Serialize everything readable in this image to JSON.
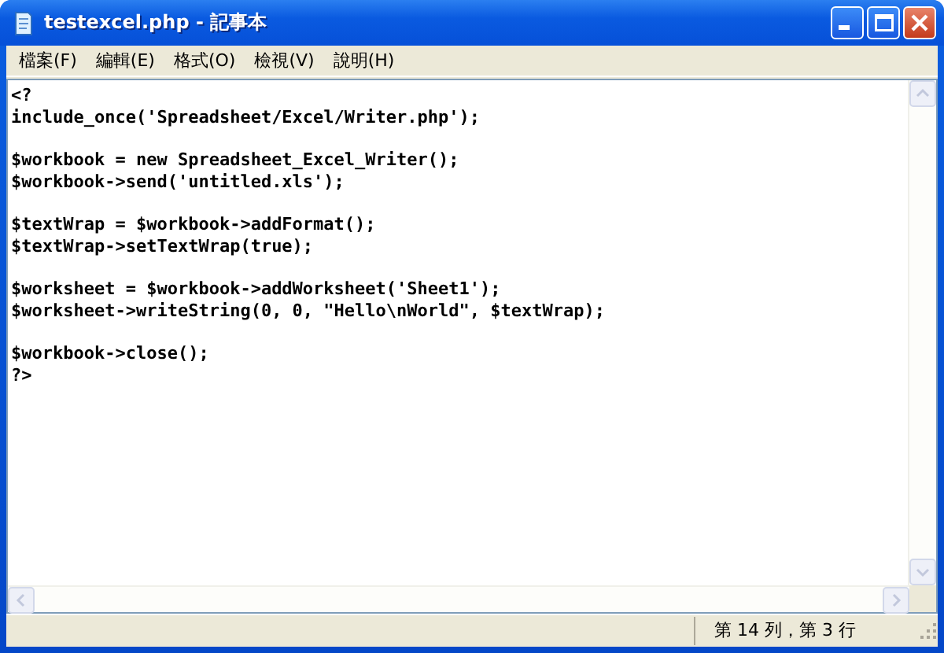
{
  "window": {
    "title": "testexcel.php - 記事本"
  },
  "menu": [
    "檔案(F)",
    "編輯(E)",
    "格式(O)",
    "檢視(V)",
    "說明(H)"
  ],
  "editor": {
    "paragraphs": [
      [
        "<?",
        "include_once('Spreadsheet/Excel/Writer.php');"
      ],
      [
        "$workbook = new Spreadsheet_Excel_Writer();",
        "$workbook->send('untitled.xls');"
      ],
      [
        "$textWrap = $workbook->addFormat();",
        "$textWrap->setTextWrap(true);"
      ],
      [
        "$worksheet = $workbook->addWorksheet('Sheet1');",
        "$worksheet->writeString(0, 0, \"Hello\\nWorld\", $textWrap);"
      ],
      [
        "$workbook->close();",
        "?>"
      ]
    ]
  },
  "status_bar": {
    "position": "第 14 列，第 3 行"
  }
}
